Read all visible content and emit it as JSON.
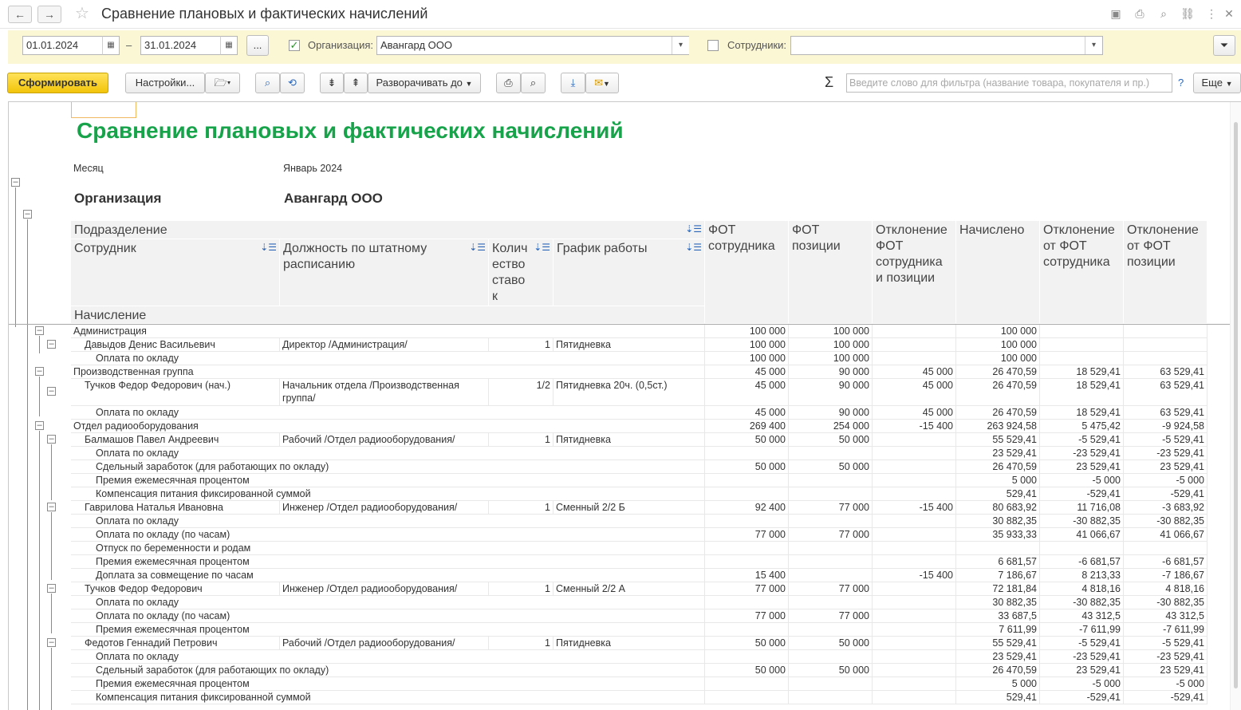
{
  "window": {
    "title": "Сравнение плановых и фактических начислений"
  },
  "filters": {
    "date_from": "01.01.2024",
    "date_to": "31.01.2024",
    "dash": "–",
    "more": "...",
    "org_label": "Организация:",
    "org_value": "Авангард ООО",
    "org_checked": true,
    "emp_label": "Сотрудники:",
    "emp_value": "",
    "emp_checked": false
  },
  "toolbar": {
    "generate": "Сформировать",
    "settings": "Настройки...",
    "expand_to": "Разворачивать до",
    "search_placeholder": "Введите слово для фильтра (название товара, покупателя и пр.)",
    "help": "?",
    "more": "Еще",
    "sum_symbol": "Σ"
  },
  "report": {
    "title": "Сравнение плановых и фактических начислений",
    "month_label": "Месяц",
    "month_value": "Январь 2024",
    "org_label": "Организация",
    "org_value": "Авангард ООО",
    "headers": {
      "subdivision": "Подразделение",
      "employee": "Сотрудник",
      "position": "Должность по штатному расписанию",
      "rates": "Количество ставок",
      "schedule": "График работы",
      "accrual": "Начисление",
      "fot_emp": "ФОТ сотрудника",
      "fot_pos": "ФОТ позиции",
      "dev_emp_pos": "Отклонение ФОТ сотрудника и позиции",
      "accrued": "Начислено",
      "dev_from_emp": "Отклонение от ФОТ сотрудника",
      "dev_from_pos": "Отклонение от ФОТ позиции"
    },
    "rows": [
      {
        "level": 0,
        "name": "Администрация",
        "pos": "",
        "rate": "",
        "sched": "",
        "fot_emp": "100 000",
        "fot_pos": "100 000",
        "dev": "",
        "accr": "100 000",
        "d1": "",
        "d2": ""
      },
      {
        "level": 1,
        "name": "Давыдов Денис Васильевич",
        "pos": "Директор /Администрация/",
        "rate": "1",
        "sched": "Пятидневка",
        "fot_emp": "100 000",
        "fot_pos": "100 000",
        "dev": "",
        "accr": "100 000",
        "d1": "",
        "d2": ""
      },
      {
        "level": 2,
        "name": "Оплата по окладу",
        "pos": "",
        "rate": "",
        "sched": "",
        "fot_emp": "100 000",
        "fot_pos": "100 000",
        "dev": "",
        "accr": "100 000",
        "d1": "",
        "d2": ""
      },
      {
        "level": 0,
        "name": "Производственная группа",
        "pos": "",
        "rate": "",
        "sched": "",
        "fot_emp": "45 000",
        "fot_pos": "90 000",
        "dev": "45 000",
        "accr": "26 470,59",
        "d1": "18 529,41",
        "d2": "63 529,41"
      },
      {
        "level": 1,
        "name": "Тучков Федор Федорович (нач.)",
        "pos": "Начальник отдела /Производственная группа/",
        "rate": "1/2",
        "sched": "Пятидневка 20ч. (0,5ст.)",
        "fot_emp": "45 000",
        "fot_pos": "90 000",
        "dev": "45 000",
        "accr": "26 470,59",
        "d1": "18 529,41",
        "d2": "63 529,41",
        "tall": true
      },
      {
        "level": 2,
        "name": "Оплата по окладу",
        "pos": "",
        "rate": "",
        "sched": "",
        "fot_emp": "45 000",
        "fot_pos": "90 000",
        "dev": "45 000",
        "accr": "26 470,59",
        "d1": "18 529,41",
        "d2": "63 529,41"
      },
      {
        "level": 0,
        "name": "Отдел радиооборудования",
        "pos": "",
        "rate": "",
        "sched": "",
        "fot_emp": "269 400",
        "fot_pos": "254 000",
        "dev": "-15 400",
        "accr": "263 924,58",
        "d1": "5 475,42",
        "d2": "-9 924,58"
      },
      {
        "level": 1,
        "name": "Балмашов Павел Андреевич",
        "pos": "Рабочий /Отдел радиооборудования/",
        "rate": "1",
        "sched": "Пятидневка",
        "fot_emp": "50 000",
        "fot_pos": "50 000",
        "dev": "",
        "accr": "55 529,41",
        "d1": "-5 529,41",
        "d2": "-5 529,41"
      },
      {
        "level": 2,
        "name": "Оплата по окладу",
        "pos": "",
        "rate": "",
        "sched": "",
        "fot_emp": "",
        "fot_pos": "",
        "dev": "",
        "accr": "23 529,41",
        "d1": "-23 529,41",
        "d2": "-23 529,41"
      },
      {
        "level": 2,
        "name": "Сдельный заработок (для работающих по окладу)",
        "pos": "",
        "rate": "",
        "sched": "",
        "fot_emp": "50 000",
        "fot_pos": "50 000",
        "dev": "",
        "accr": "26 470,59",
        "d1": "23 529,41",
        "d2": "23 529,41"
      },
      {
        "level": 2,
        "name": "Премия ежемесячная процентом",
        "pos": "",
        "rate": "",
        "sched": "",
        "fot_emp": "",
        "fot_pos": "",
        "dev": "",
        "accr": "5 000",
        "d1": "-5 000",
        "d2": "-5 000"
      },
      {
        "level": 2,
        "name": "Компенсация питания фиксированной суммой",
        "pos": "",
        "rate": "",
        "sched": "",
        "fot_emp": "",
        "fot_pos": "",
        "dev": "",
        "accr": "529,41",
        "d1": "-529,41",
        "d2": "-529,41"
      },
      {
        "level": 1,
        "name": "Гаврилова Наталья Ивановна",
        "pos": "Инженер /Отдел радиооборудования/",
        "rate": "1",
        "sched": "Сменный 2/2 Б",
        "fot_emp": "92 400",
        "fot_pos": "77 000",
        "dev": "-15 400",
        "accr": "80 683,92",
        "d1": "11 716,08",
        "d2": "-3 683,92"
      },
      {
        "level": 2,
        "name": "Оплата по окладу",
        "pos": "",
        "rate": "",
        "sched": "",
        "fot_emp": "",
        "fot_pos": "",
        "dev": "",
        "accr": "30 882,35",
        "d1": "-30 882,35",
        "d2": "-30 882,35"
      },
      {
        "level": 2,
        "name": "Оплата по окладу (по часам)",
        "pos": "",
        "rate": "",
        "sched": "",
        "fot_emp": "77 000",
        "fot_pos": "77 000",
        "dev": "",
        "accr": "35 933,33",
        "d1": "41 066,67",
        "d2": "41 066,67"
      },
      {
        "level": 2,
        "name": "Отпуск по беременности и родам",
        "pos": "",
        "rate": "",
        "sched": "",
        "fot_emp": "",
        "fot_pos": "",
        "dev": "",
        "accr": "",
        "d1": "",
        "d2": ""
      },
      {
        "level": 2,
        "name": "Премия ежемесячная процентом",
        "pos": "",
        "rate": "",
        "sched": "",
        "fot_emp": "",
        "fot_pos": "",
        "dev": "",
        "accr": "6 681,57",
        "d1": "-6 681,57",
        "d2": "-6 681,57"
      },
      {
        "level": 2,
        "name": "Доплата за совмещение по часам",
        "pos": "",
        "rate": "",
        "sched": "",
        "fot_emp": "15 400",
        "fot_pos": "",
        "dev": "-15 400",
        "accr": "7 186,67",
        "d1": "8 213,33",
        "d2": "-7 186,67"
      },
      {
        "level": 1,
        "name": "Тучков Федор Федорович",
        "pos": "Инженер /Отдел радиооборудования/",
        "rate": "1",
        "sched": "Сменный 2/2 А",
        "fot_emp": "77 000",
        "fot_pos": "77 000",
        "dev": "",
        "accr": "72 181,84",
        "d1": "4 818,16",
        "d2": "4 818,16"
      },
      {
        "level": 2,
        "name": "Оплата по окладу",
        "pos": "",
        "rate": "",
        "sched": "",
        "fot_emp": "",
        "fot_pos": "",
        "dev": "",
        "accr": "30 882,35",
        "d1": "-30 882,35",
        "d2": "-30 882,35"
      },
      {
        "level": 2,
        "name": "Оплата по окладу (по часам)",
        "pos": "",
        "rate": "",
        "sched": "",
        "fot_emp": "77 000",
        "fot_pos": "77 000",
        "dev": "",
        "accr": "33 687,5",
        "d1": "43 312,5",
        "d2": "43 312,5"
      },
      {
        "level": 2,
        "name": "Премия ежемесячная процентом",
        "pos": "",
        "rate": "",
        "sched": "",
        "fot_emp": "",
        "fot_pos": "",
        "dev": "",
        "accr": "7 611,99",
        "d1": "-7 611,99",
        "d2": "-7 611,99"
      },
      {
        "level": 1,
        "name": "Федотов Геннадий Петрович",
        "pos": "Рабочий /Отдел радиооборудования/",
        "rate": "1",
        "sched": "Пятидневка",
        "fot_emp": "50 000",
        "fot_pos": "50 000",
        "dev": "",
        "accr": "55 529,41",
        "d1": "-5 529,41",
        "d2": "-5 529,41"
      },
      {
        "level": 2,
        "name": "Оплата по окладу",
        "pos": "",
        "rate": "",
        "sched": "",
        "fot_emp": "",
        "fot_pos": "",
        "dev": "",
        "accr": "23 529,41",
        "d1": "-23 529,41",
        "d2": "-23 529,41"
      },
      {
        "level": 2,
        "name": "Сдельный заработок (для работающих по окладу)",
        "pos": "",
        "rate": "",
        "sched": "",
        "fot_emp": "50 000",
        "fot_pos": "50 000",
        "dev": "",
        "accr": "26 470,59",
        "d1": "23 529,41",
        "d2": "23 529,41"
      },
      {
        "level": 2,
        "name": "Премия ежемесячная процентом",
        "pos": "",
        "rate": "",
        "sched": "",
        "fot_emp": "",
        "fot_pos": "",
        "dev": "",
        "accr": "5 000",
        "d1": "-5 000",
        "d2": "-5 000"
      },
      {
        "level": 2,
        "name": "Компенсация питания фиксированной суммой",
        "pos": "",
        "rate": "",
        "sched": "",
        "fot_emp": "",
        "fot_pos": "",
        "dev": "",
        "accr": "529,41",
        "d1": "-529,41",
        "d2": "-529,41"
      }
    ]
  }
}
